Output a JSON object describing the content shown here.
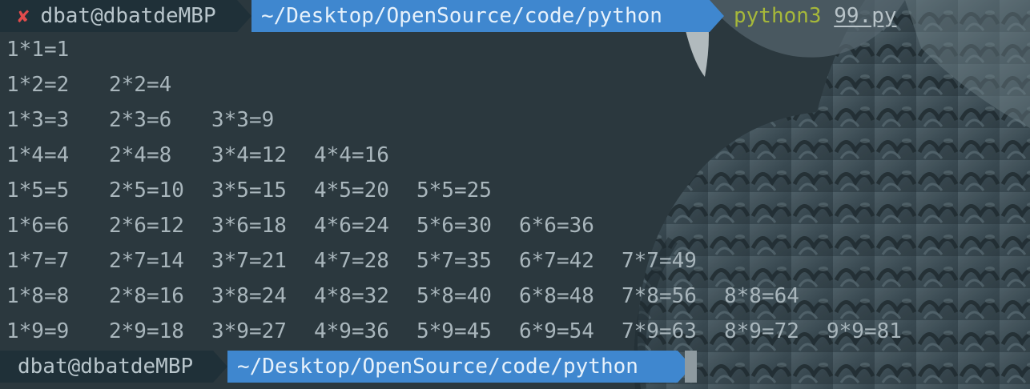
{
  "colors": {
    "background": "#2b383e",
    "user_segment_bg": "#1f3038",
    "path_segment_bg": "#3f87cf",
    "error_icon": "#e24c4c",
    "command_name": "#a6b83a",
    "output_text": "#a9b6bc"
  },
  "prompt1": {
    "status_icon": "error-x-icon",
    "status_glyph": "✘",
    "user_host": "dbat@dbatdeMBP",
    "path": "~/Desktop/OpenSource/code/python",
    "command": "python3",
    "argument": "99.py"
  },
  "output_rows": [
    [
      "1*1=1"
    ],
    [
      "1*2=2",
      "2*2=4"
    ],
    [
      "1*3=3",
      "2*3=6",
      "3*3=9"
    ],
    [
      "1*4=4",
      "2*4=8",
      "3*4=12",
      "4*4=16"
    ],
    [
      "1*5=5",
      "2*5=10",
      "3*5=15",
      "4*5=20",
      "5*5=25"
    ],
    [
      "1*6=6",
      "2*6=12",
      "3*6=18",
      "4*6=24",
      "5*6=30",
      "6*6=36"
    ],
    [
      "1*7=7",
      "2*7=14",
      "3*7=21",
      "4*7=28",
      "5*7=35",
      "6*7=42",
      "7*7=49"
    ],
    [
      "1*8=8",
      "2*8=16",
      "3*8=24",
      "4*8=32",
      "5*8=40",
      "6*8=48",
      "7*8=56",
      "8*8=64"
    ],
    [
      "1*9=9",
      "2*9=18",
      "3*9=27",
      "4*9=36",
      "5*9=45",
      "6*9=54",
      "7*9=63",
      "8*9=72",
      "9*9=81"
    ]
  ],
  "prompt2": {
    "user_host": "dbat@dbatdeMBP",
    "path": "~/Desktop/OpenSource/code/python"
  },
  "background_image": "owl-wallpaper"
}
